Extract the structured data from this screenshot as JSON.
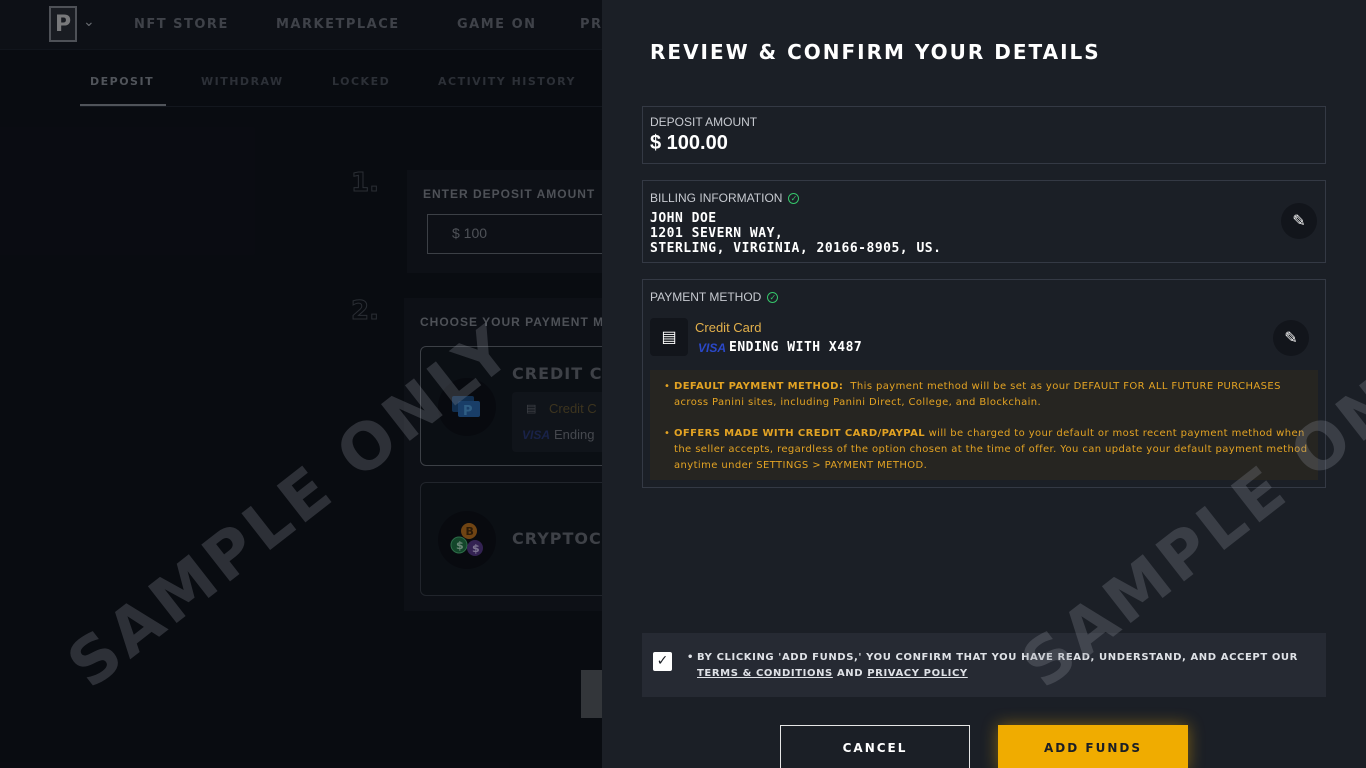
{
  "nav": {
    "logo_letter": "P",
    "items": [
      "NFT STORE",
      "MARKETPLACE",
      "GAME ON",
      "PR"
    ]
  },
  "tabs": [
    "DEPOSIT",
    "WITHDRAW",
    "LOCKED",
    "ACTIVITY HISTORY"
  ],
  "steps": {
    "step1_number": "1.",
    "step1_label": "ENTER DEPOSIT AMOUNT",
    "amount_input_value": "$ 100",
    "step2_number": "2.",
    "step2_label": "CHOOSE YOUR PAYMENT ME",
    "credit_card_title": "CREDIT CA",
    "credit_card_sub": "Credit C",
    "visa_label": "VISA",
    "credit_card_ending": "Ending",
    "crypto_title": "CRYPTOCU"
  },
  "watermark": "SAMPLE ONLY",
  "drawer": {
    "title": "REVIEW & CONFIRM YOUR DETAILS",
    "deposit": {
      "label": "DEPOSIT AMOUNT",
      "value": "$ 100.00"
    },
    "billing": {
      "label": "BILLING INFORMATION",
      "name": "JOHN DOE",
      "address1": "1201 SEVERN WAY,",
      "address2": "STERLING, VIRGINIA, 20166-8905, US."
    },
    "payment": {
      "label": "PAYMENT METHOD",
      "card_type": "Credit Card",
      "brand": "VISA",
      "ending": "ENDING WITH X487",
      "notice1_title": "DEFAULT PAYMENT METHOD:",
      "notice1_body": "This payment method will be set as your DEFAULT FOR ALL FUTURE PURCHASES across Panini sites, including Panini Direct, College, and Blockchain.",
      "notice2_title": "OFFERS MADE WITH CREDIT CARD/PAYPAL",
      "notice2_body": "will be charged to your default or most recent payment method when the seller accepts, regardless of the option chosen at the time of offer. You can update your default payment method anytime under SETTINGS > PAYMENT METHOD."
    },
    "terms": {
      "prefix": "BY CLICKING 'ADD FUNDS,' YOU CONFIRM THAT YOU HAVE READ, UNDERSTAND, AND ACCEPT OUR",
      "terms_link": "TERMS & CONDITIONS",
      "and": "AND",
      "privacy_link": "PRIVACY POLICY",
      "checked": true
    },
    "buttons": {
      "cancel": "CANCEL",
      "add_funds": "ADD FUNDS"
    }
  },
  "colors": {
    "accent": "#f0ac00",
    "notice_text": "#e3a323",
    "verified": "#35c46a",
    "visa_blue": "#2a48c9"
  }
}
